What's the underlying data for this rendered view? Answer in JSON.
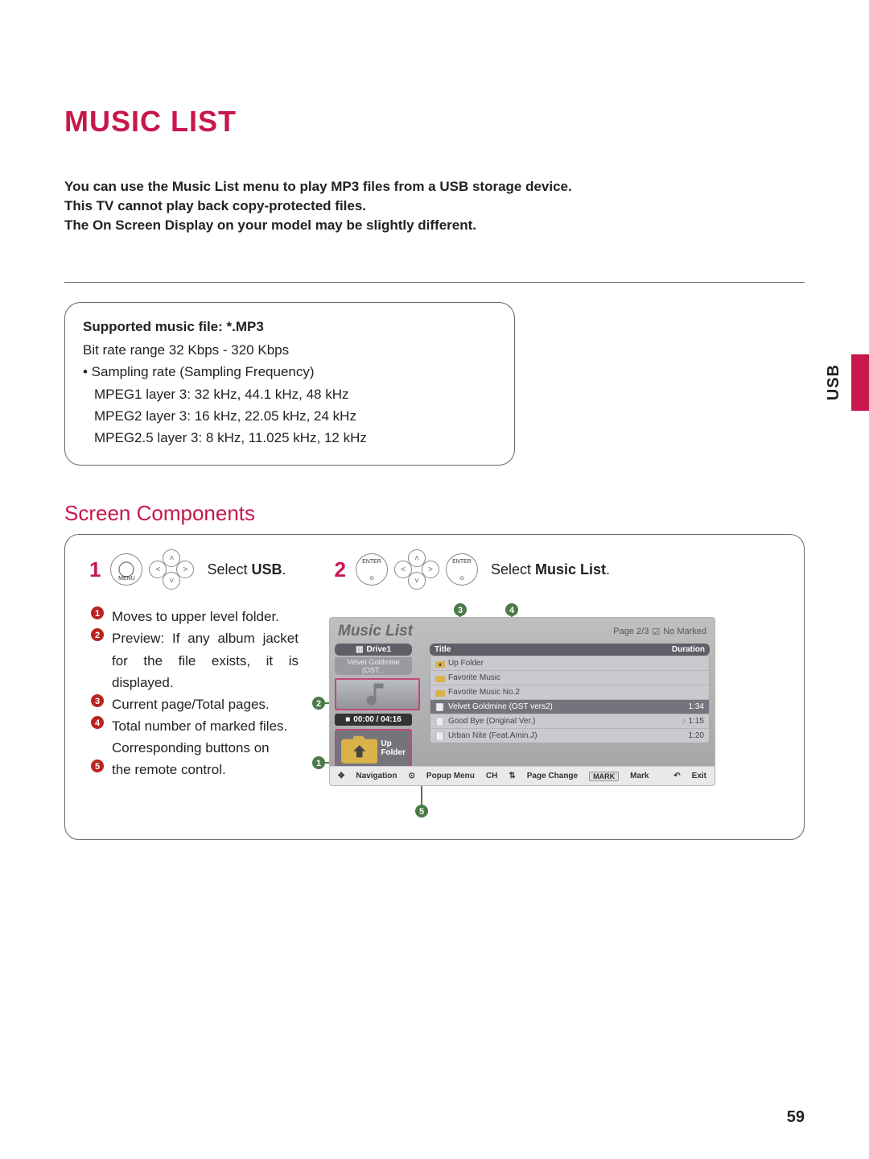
{
  "title": "MUSIC LIST",
  "intro": [
    "You can use the Music List menu to play MP3 files from a USB storage device.",
    "This TV cannot play back copy-protected files.",
    "The On Screen Display on your model may be slightly different."
  ],
  "side_label": "USB",
  "spec": {
    "title": "Supported music file: *.MP3",
    "bitrate": "Bit rate range 32 Kbps - 320 Kbps",
    "sampling_head": "• Sampling rate (Sampling Frequency)",
    "m1": "MPEG1 layer 3: 32 kHz, 44.1 kHz, 48 kHz",
    "m2": "MPEG2 layer 3: 16 kHz, 22.05  kHz, 24 kHz",
    "m25": "MPEG2.5 layer 3: 8 kHz, 11.025 kHz, 12 kHz"
  },
  "sub_heading": "Screen Components",
  "steps": {
    "s1_num": "1",
    "s1_menu": "MENU",
    "s1_text_prefix": "Select ",
    "s1_text_bold": "USB",
    "s1_text_suffix": ".",
    "s2_num": "2",
    "s2_enter": "ENTER",
    "s2_text_prefix": "Select ",
    "s2_text_bold": "Music List",
    "s2_text_suffix": "."
  },
  "legend": {
    "l1": "Moves to upper level folder.",
    "l2": "Preview: If any album jacket for the file exists, it is displayed.",
    "l3": "Current page/Total pages.",
    "l4": "Total number of marked files.",
    "l5a": "Corresponding buttons on",
    "l5b": "the remote control."
  },
  "osd": {
    "title": "Music List",
    "page": "Page 2/3",
    "marked": "No Marked",
    "drive": "Drive1",
    "subtitle": "Velvet Goldmine (OST...",
    "progress": "00:00 / 04:16",
    "upfolder": "Up Folder",
    "col_title": "Title",
    "col_duration": "Duration",
    "rows": [
      {
        "title": "Up Folder",
        "duration": "",
        "icon": "upfolder",
        "selected": false
      },
      {
        "title": "Favorite Music",
        "duration": "",
        "icon": "folder",
        "selected": false
      },
      {
        "title": "Favorite Music No.2",
        "duration": "",
        "icon": "folder",
        "selected": false
      },
      {
        "title": "Velvet Goldmine (OST vers2)",
        "duration": "1:34",
        "icon": "file",
        "selected": true
      },
      {
        "title": "Good Bye (Original Ver.)",
        "duration": "1:15",
        "icon": "file",
        "selected": false,
        "playing": true
      },
      {
        "title": "Urban Nite (Feat.Amin.J)",
        "duration": "1:20",
        "icon": "file",
        "selected": false
      }
    ],
    "footer": {
      "nav": "Navigation",
      "popup": "Popup Menu",
      "page_change": "Page Change",
      "ch": "CH",
      "mark_btn": "MARK",
      "mark": "Mark",
      "exit": "Exit"
    }
  },
  "page_number": "59"
}
